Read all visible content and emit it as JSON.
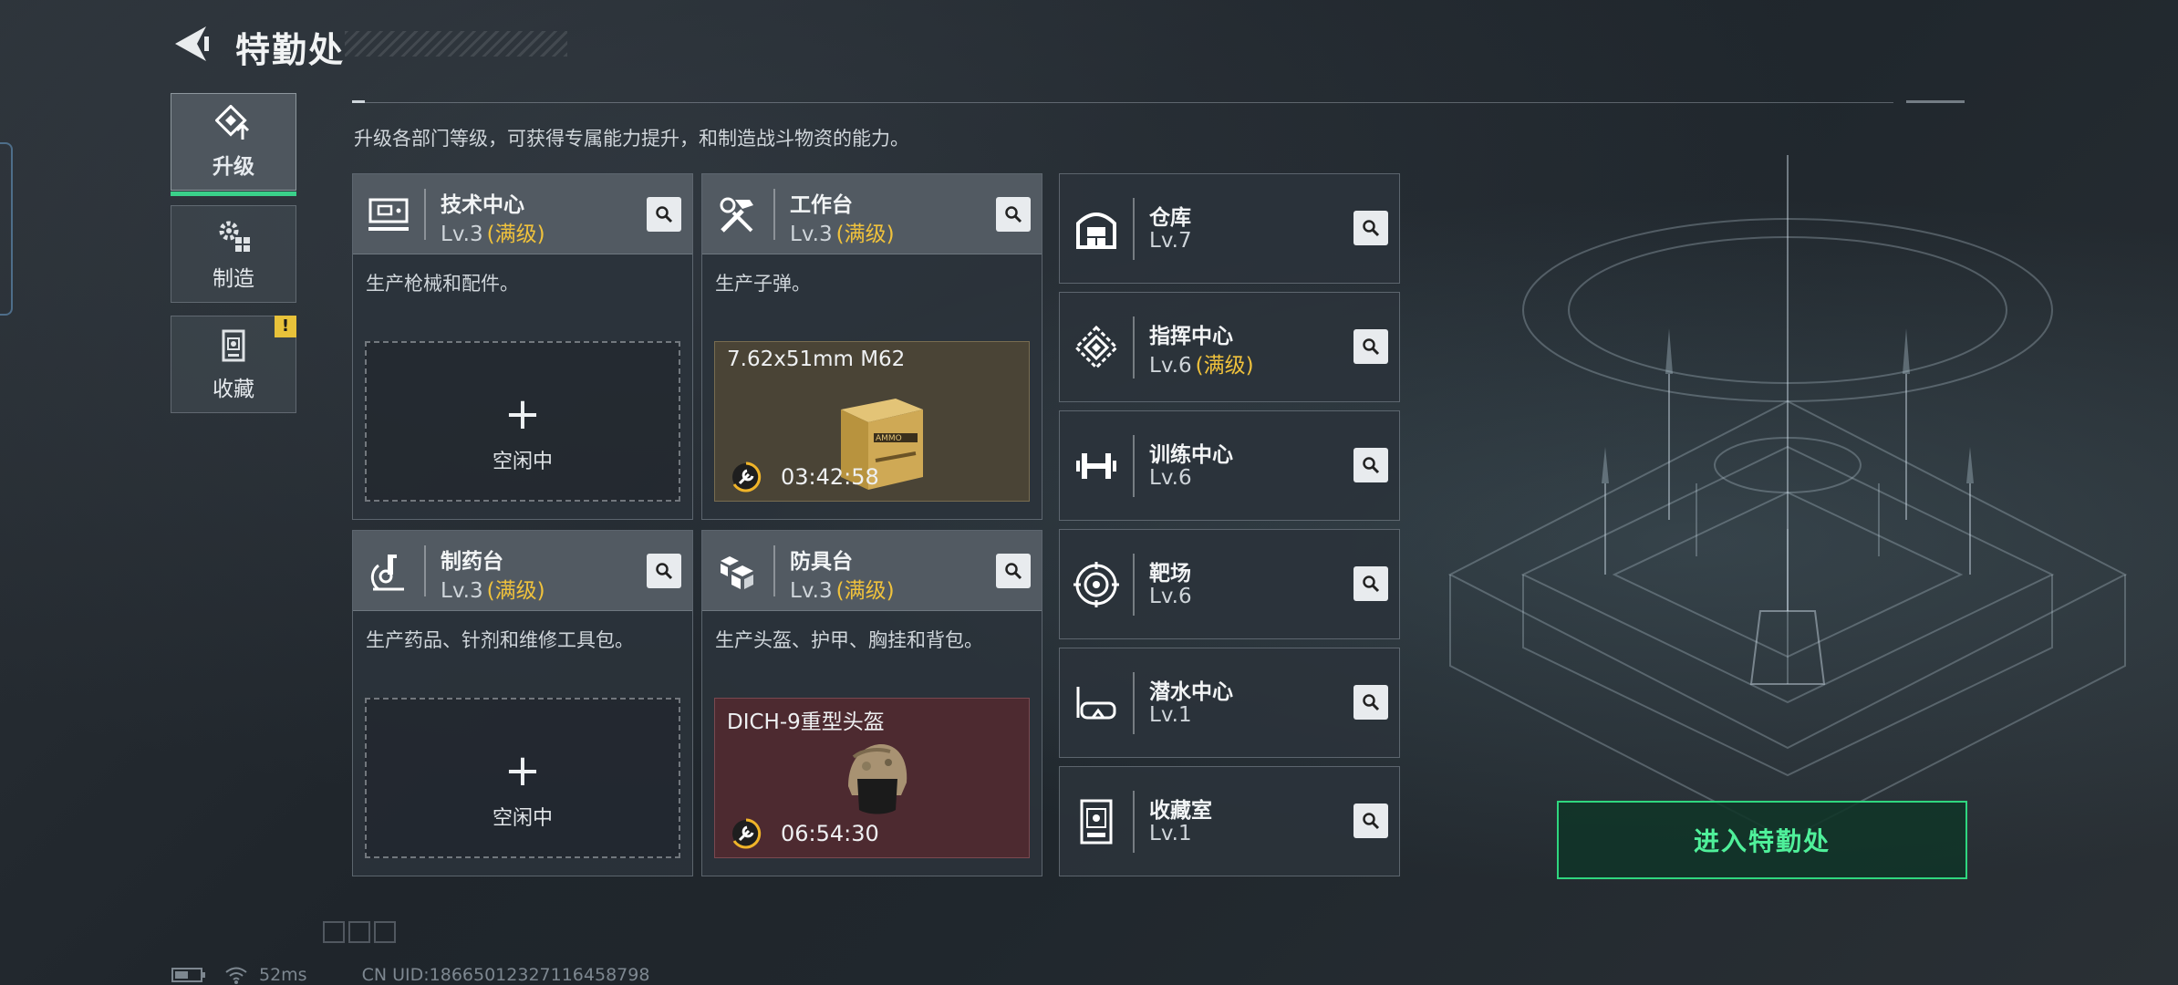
{
  "header": {
    "title": "特勤处",
    "back_icon": "back-arrow-icon"
  },
  "intro": "升级各部门等级，可获得专属能力提升，和制造战斗物资的能力。",
  "side_nav": [
    {
      "label": "升级",
      "icon": "upgrade-icon",
      "active": true
    },
    {
      "label": "制造",
      "icon": "gears-icon",
      "active": false
    },
    {
      "label": "收藏",
      "icon": "collection-icon",
      "active": false,
      "alert": "!"
    }
  ],
  "dept_cards": [
    {
      "name": "技术中心",
      "level": "Lv.3",
      "status": "(满级)",
      "desc": "生产枪械和配件。",
      "icon": "tech-center-icon",
      "slot": {
        "type": "idle",
        "plus": "+",
        "text": "空闲中"
      }
    },
    {
      "name": "工作台",
      "level": "Lv.3",
      "status": "(满级)",
      "desc": "生产子弹。",
      "icon": "workbench-icon",
      "slot": {
        "type": "producing",
        "item": "7.62x51mm M62",
        "time": "03:42:58",
        "box_label": "AMMO"
      }
    },
    {
      "name": "制药台",
      "level": "Lv.3",
      "status": "(满级)",
      "desc": "生产药品、针剂和维修工具包。",
      "icon": "pharmacy-icon",
      "slot": {
        "type": "idle",
        "plus": "+",
        "text": "空闲中"
      }
    },
    {
      "name": "防具台",
      "level": "Lv.3",
      "status": "(满级)",
      "desc": "生产头盔、护甲、胸挂和背包。",
      "icon": "armor-bench-icon",
      "slot": {
        "type": "producing",
        "item": "DICH-9重型头盔",
        "time": "06:54:30"
      }
    }
  ],
  "rooms": [
    {
      "name": "仓库",
      "level": "Lv.7",
      "status": "",
      "icon": "warehouse-icon"
    },
    {
      "name": "指挥中心",
      "level": "Lv.6",
      "status": "(满级)",
      "icon": "command-center-icon"
    },
    {
      "name": "训练中心",
      "level": "Lv.6",
      "status": "",
      "icon": "dumbbell-icon"
    },
    {
      "name": "靶场",
      "level": "Lv.6",
      "status": "",
      "icon": "target-icon"
    },
    {
      "name": "潜水中心",
      "level": "Lv.1",
      "status": "",
      "icon": "diving-mask-icon"
    },
    {
      "name": "收藏室",
      "level": "Lv.1",
      "status": "",
      "icon": "collection-room-icon"
    }
  ],
  "cta": {
    "label": "进入特勤处"
  },
  "status_bar": {
    "ping": "52ms",
    "uid": "CN UID:18665012327116458798"
  },
  "colors": {
    "accent_green": "#2fd67f",
    "maxed_gold": "#f0c23c",
    "ammo_bg": "#4a4436",
    "helmet_bg": "#4d2a30"
  }
}
